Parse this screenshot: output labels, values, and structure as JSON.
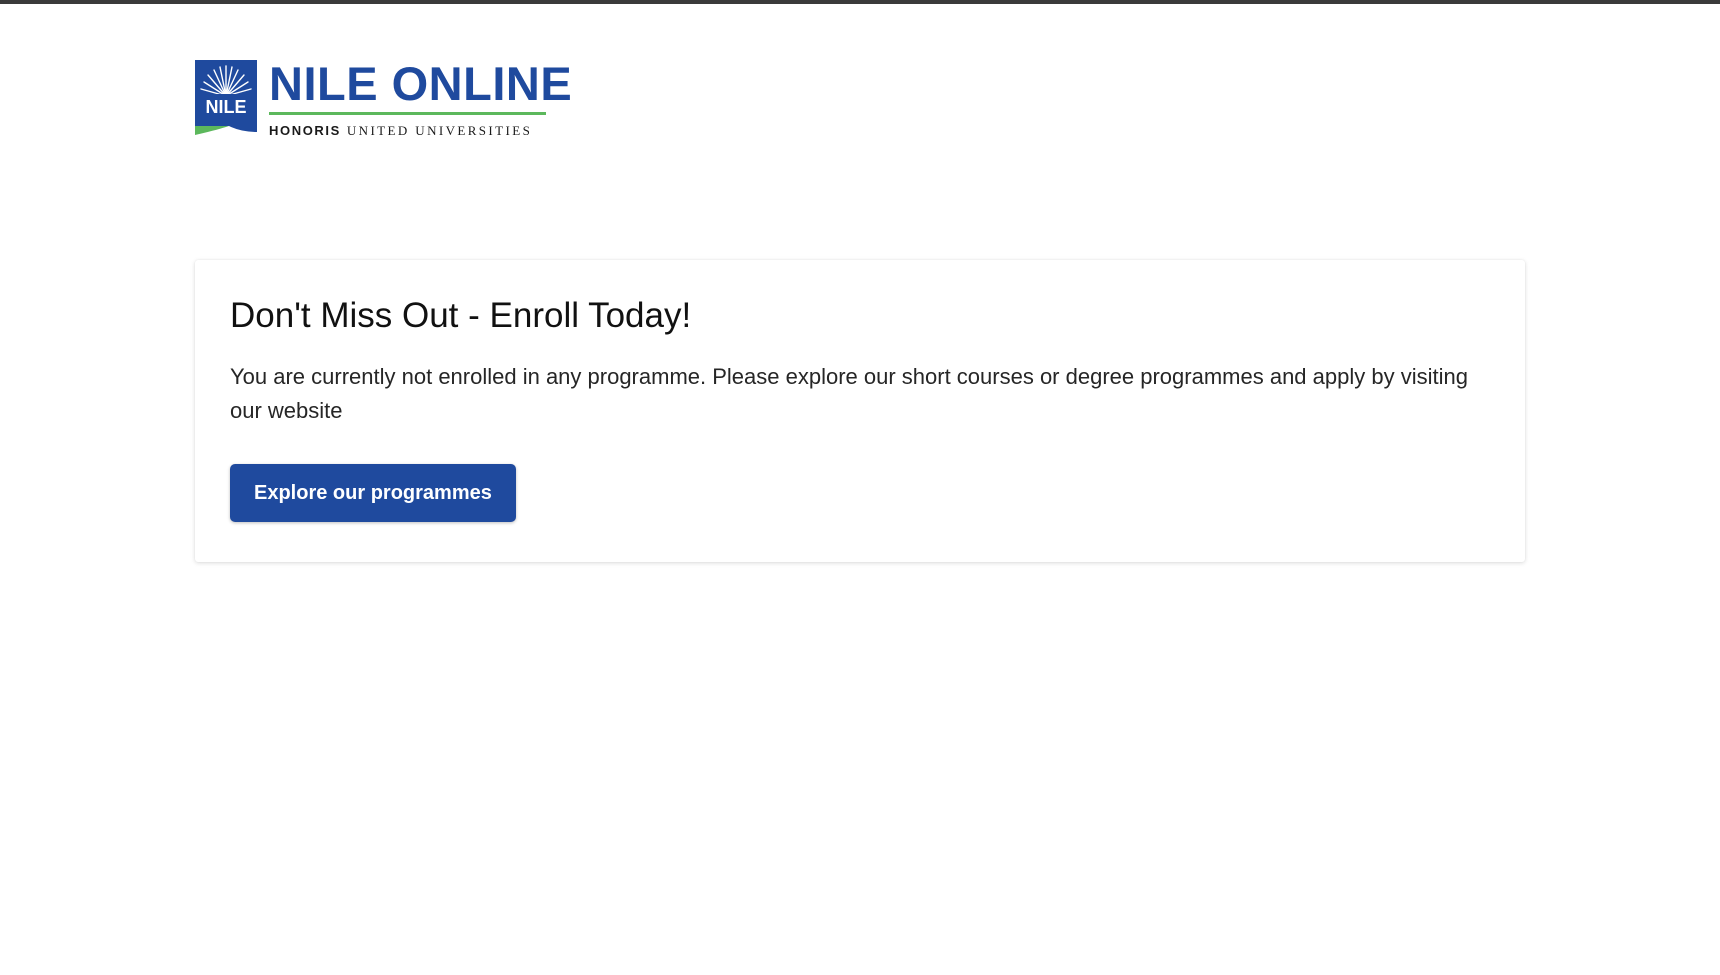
{
  "header": {
    "logo": {
      "mark_text": "NILE",
      "wordmark": "NILE ONLINE",
      "tagline_strong": "HONORIS",
      "tagline_serif": "UNITED UNIVERSITIES"
    }
  },
  "card": {
    "title": "Don't Miss Out - Enroll Today!",
    "body": "You are currently not enrolled in any programme. Please explore our short courses or degree programmes and apply by visiting our website",
    "button_label": "Explore our programmes"
  },
  "colors": {
    "brand_blue": "#1f4a9e",
    "brand_green": "#5cb85c",
    "top_rule": "#3a3a3a"
  }
}
